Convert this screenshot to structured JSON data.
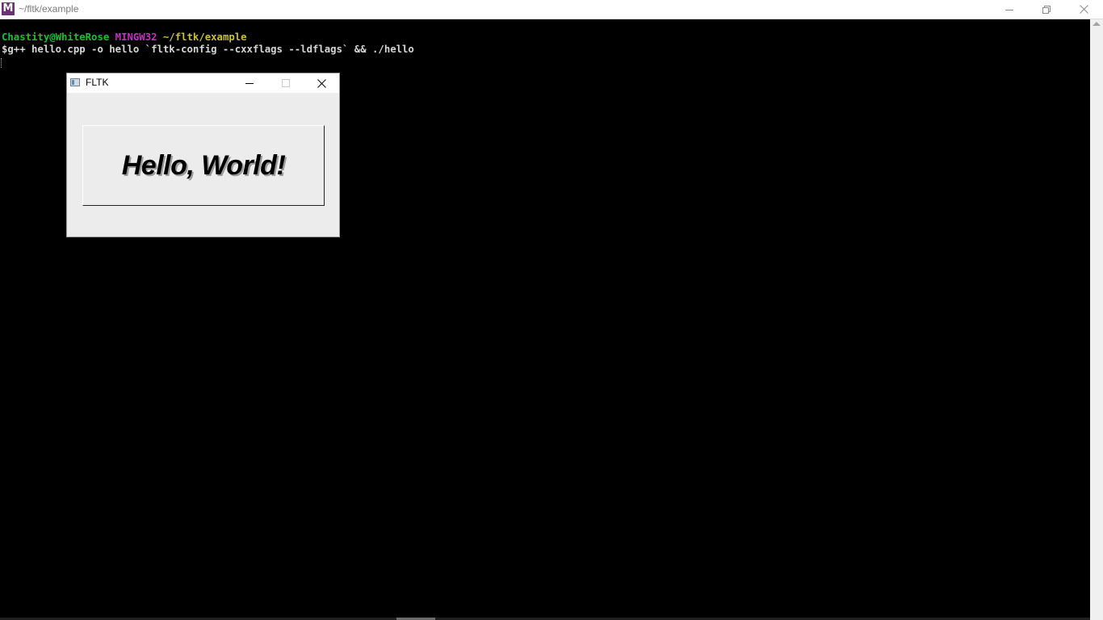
{
  "window": {
    "app_icon_letter": "M",
    "title": "~/fltk/example",
    "controls": {
      "minimize_icon": "minimize-icon",
      "maximize_icon": "restore-icon",
      "close_icon": "close-icon"
    }
  },
  "terminal": {
    "prompt": {
      "user_host": "Chastity@WhiteRose",
      "system": "MINGW32",
      "path": "~/fltk/example"
    },
    "command": "$g++ hello.cpp -o hello `fltk-config --cxxflags --ldflags` && ./hello",
    "colors": {
      "user_host": "#1dbf3a",
      "system": "#c034c0",
      "path": "#c9c22e",
      "text": "#d6d6d6",
      "background": "#000000"
    }
  },
  "fltk_window": {
    "title": "FLTK",
    "box_label": "Hello, World!",
    "background": "#ececec"
  }
}
